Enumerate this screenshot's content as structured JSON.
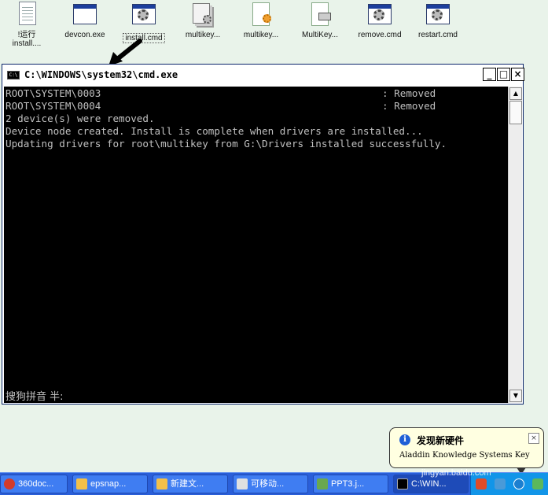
{
  "desktop": {
    "icons": [
      {
        "label": "!运行\ninstall...."
      },
      {
        "label": "devcon.exe"
      },
      {
        "label": "install.cmd"
      },
      {
        "label": "multikey..."
      },
      {
        "label": "multikey..."
      },
      {
        "label": "MultiKey..."
      },
      {
        "label": "remove.cmd"
      },
      {
        "label": "restart.cmd"
      }
    ]
  },
  "console": {
    "title": "C:\\WINDOWS\\system32\\cmd.exe",
    "icon_text": "C:\\",
    "minimize": "_",
    "maximize": "□",
    "close": "×",
    "lines": [
      {
        "text": "ROOT\\SYSTEM\\0003",
        "status": ": Removed"
      },
      {
        "text": "ROOT\\SYSTEM\\0004",
        "status": ": Removed"
      },
      {
        "text": "2 device(s) were removed."
      },
      {
        "text": "Device node created. Install is complete when drivers are installed..."
      },
      {
        "text": "Updating drivers for root\\multikey from G:\\Drivers installed successfully."
      }
    ],
    "ime_status": "搜狗拼音 半:",
    "scroll_up": "▲",
    "scroll_down": "▼"
  },
  "balloon": {
    "title": "发现新硬件",
    "text": "Aladdin Knowledge Systems Key",
    "close": "×",
    "info": "i"
  },
  "taskbar": {
    "items": [
      {
        "label": "360doc...",
        "color": "#d33b2a"
      },
      {
        "label": "epsnap...",
        "color": "#f3c04a"
      },
      {
        "label": "新建文...",
        "color": "#f3c04a"
      },
      {
        "label": "可移动...",
        "color": "#e0e0e0"
      },
      {
        "label": "PPT3.j...",
        "color": "#6aa84f"
      },
      {
        "label": "C:\\WIN...",
        "color": "#000000"
      }
    ],
    "watermark": "jingyan.baidu.com"
  }
}
